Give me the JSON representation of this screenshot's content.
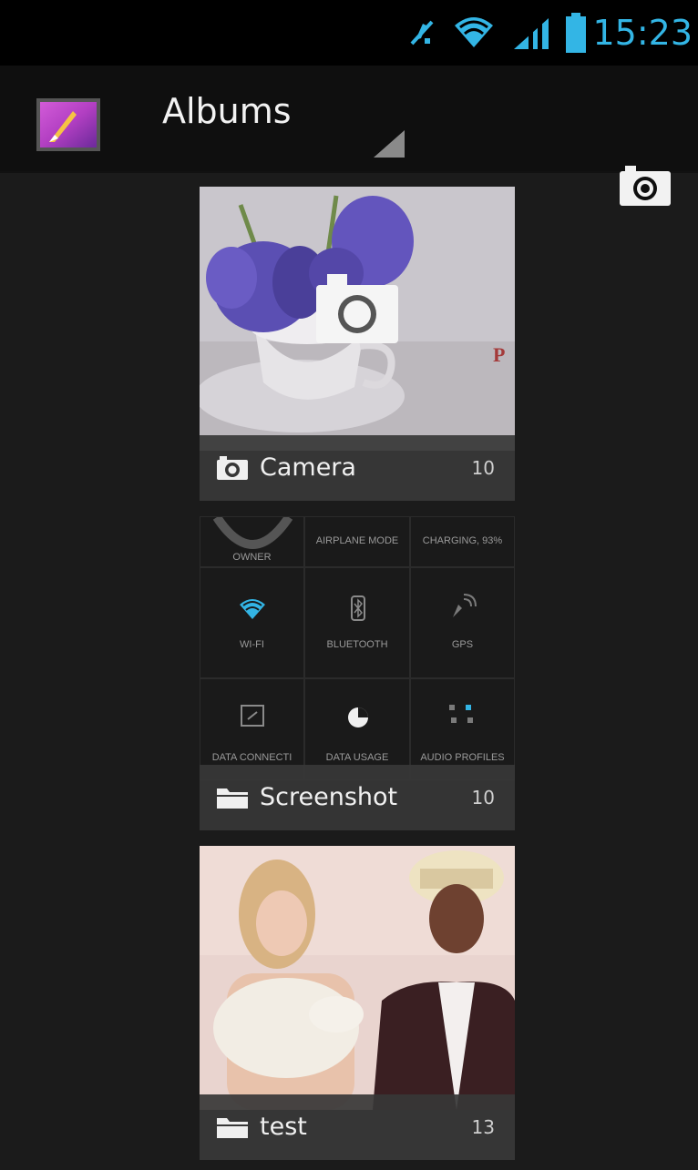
{
  "status_bar": {
    "time": "15:23",
    "icons": [
      "muted-icon",
      "wifi-icon",
      "signal-icon",
      "battery-icon"
    ]
  },
  "action_bar": {
    "title": "Albums",
    "app_icon": "gallery-icon",
    "action_icon": "camera-icon"
  },
  "albums": [
    {
      "name": "Camera",
      "count": "10",
      "icon": "camera-icon"
    },
    {
      "name": "Screenshot",
      "count": "10",
      "icon": "folder-icon",
      "tiles": [
        "OWNER",
        "AIRPLANE MODE",
        "CHARGING, 93%",
        "WI-FI",
        "BLUETOOTH",
        "GPS",
        "DATA CONNECTI",
        "DATA USAGE",
        "AUDIO PROFILES"
      ]
    },
    {
      "name": "test",
      "count": "13",
      "icon": "folder-icon"
    }
  ],
  "colors": {
    "accent": "#33b5e5",
    "background": "#1b1b1b"
  }
}
